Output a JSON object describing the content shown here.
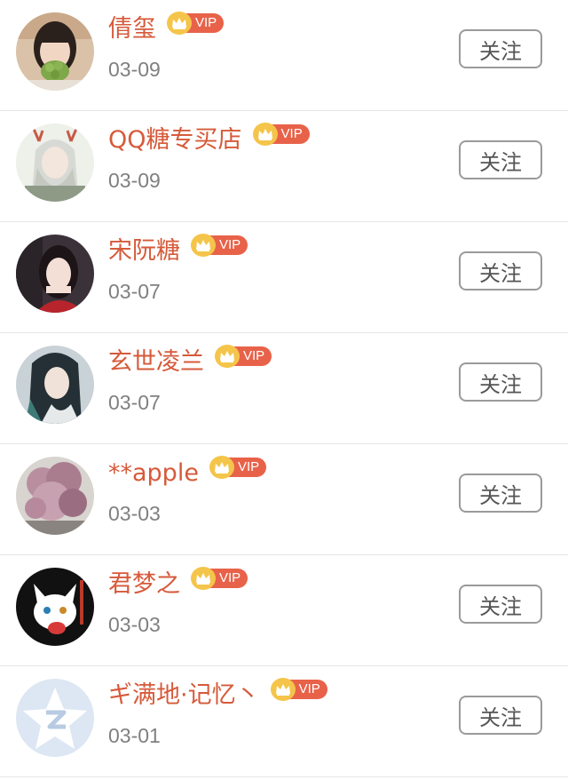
{
  "follow_label": "关注",
  "vip_label": "VIP",
  "colors": {
    "name": "#d65a3a",
    "vip_pill": "#e8624a",
    "vip_crown": "#f4c54a",
    "date": "#808080",
    "divider": "#e6e6e6"
  },
  "users": [
    {
      "name": "倩玺",
      "date": "03-09",
      "avatar_icon": "girl-with-grapes-avatar"
    },
    {
      "name": "QQ糖专买店",
      "date": "03-09",
      "avatar_icon": "anime-white-hair-antlers-avatar"
    },
    {
      "name": "宋阮糖",
      "date": "03-07",
      "avatar_icon": "girl-portrait-avatar"
    },
    {
      "name": "玄世凌兰",
      "date": "03-07",
      "avatar_icon": "anime-dark-hair-avatar"
    },
    {
      "name": "**apple",
      "date": "03-03",
      "avatar_icon": "pink-flowers-avatar"
    },
    {
      "name": "君梦之",
      "date": "03-03",
      "avatar_icon": "white-fox-cartoon-avatar"
    },
    {
      "name": "ギ满地·记忆丶",
      "date": "03-01",
      "avatar_icon": "default-star-avatar"
    }
  ]
}
